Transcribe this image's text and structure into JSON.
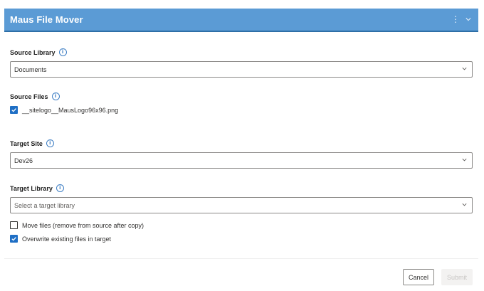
{
  "header": {
    "title": "Maus File Mover",
    "icons": [
      "more-vertical-icon",
      "chevron-down-icon"
    ]
  },
  "source_library": {
    "label": "Source Library",
    "value": "Documents"
  },
  "source_files": {
    "label": "Source Files",
    "items": [
      {
        "name": "__sitelogo__MausLogo96x96.png",
        "checked": true
      }
    ]
  },
  "target_site": {
    "label": "Target Site",
    "value": "Dev26"
  },
  "target_library": {
    "label": "Target Library",
    "placeholder": "Select a target library"
  },
  "options": {
    "move_files": {
      "label": "Move files (remove from source after copy)",
      "checked": false
    },
    "overwrite": {
      "label": "Overwrite existing files in target",
      "checked": true
    }
  },
  "footer": {
    "cancel_label": "Cancel",
    "submit_label": "Submit"
  },
  "colors": {
    "header_bg": "#5b9bd5",
    "accent": "#1f6fc5",
    "info_icon": "#3f7fc4"
  }
}
